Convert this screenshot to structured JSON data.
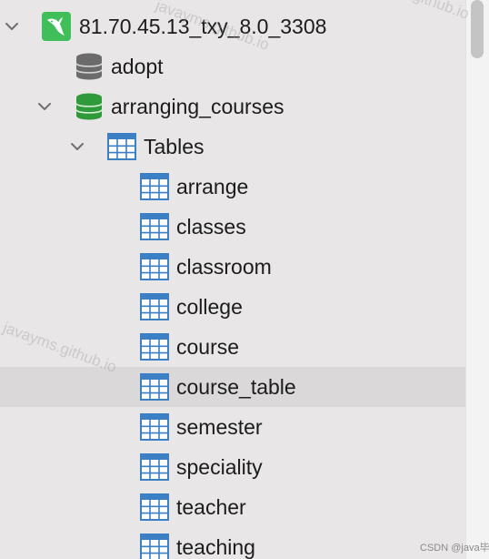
{
  "tree": {
    "connection": {
      "label": "81.70.45.13_txy_8.0_3308",
      "icon": "mysql-dolphin-icon",
      "expanded": true,
      "color": "#3fbe5a"
    },
    "databases": [
      {
        "label": "adopt",
        "icon": "database-icon",
        "open": false,
        "color": "#6b6b6b"
      },
      {
        "label": "arranging_courses",
        "icon": "database-icon",
        "open": true,
        "expanded": true,
        "color": "#2f9a3a"
      }
    ],
    "group": {
      "label": "Tables",
      "icon": "table-icon",
      "expanded": true
    },
    "tables": [
      {
        "label": "arrange",
        "selected": false
      },
      {
        "label": "classes",
        "selected": false
      },
      {
        "label": "classroom",
        "selected": false
      },
      {
        "label": "college",
        "selected": false
      },
      {
        "label": "course",
        "selected": false
      },
      {
        "label": "course_table",
        "selected": true
      },
      {
        "label": "semester",
        "selected": false
      },
      {
        "label": "speciality",
        "selected": false
      },
      {
        "label": "teacher",
        "selected": false
      },
      {
        "label": "teaching",
        "selected": false
      }
    ],
    "table_icon_color": "#3b7fc4"
  },
  "watermarks": [
    "javayms.github.io",
    "javayms.github.io",
    "javayms.github.io",
    "CSDN @java毕业"
  ]
}
